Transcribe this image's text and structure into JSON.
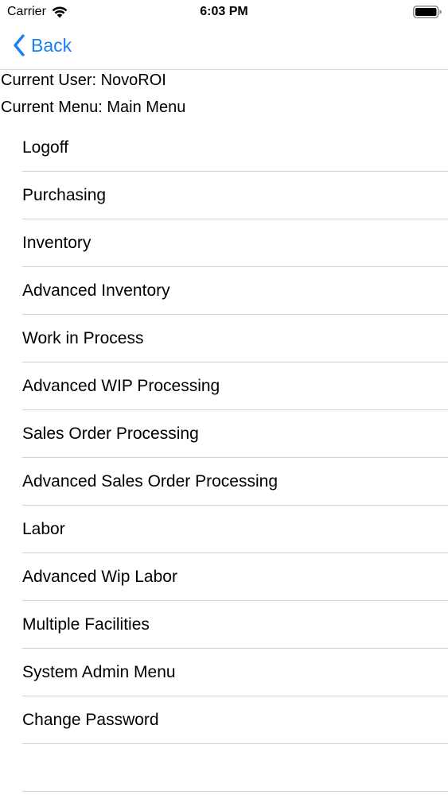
{
  "status_bar": {
    "carrier": "Carrier",
    "time": "6:03 PM",
    "wifi_icon": "wifi-icon",
    "battery_icon": "battery-icon"
  },
  "nav": {
    "back_label": "Back",
    "back_icon": "chevron-left-icon",
    "accent_color": "#1a7ff5"
  },
  "info": {
    "current_user": "Current User: NovoROI",
    "current_menu": "Current Menu: Main Menu"
  },
  "menu": {
    "items": [
      {
        "label": "Logoff"
      },
      {
        "label": "Purchasing"
      },
      {
        "label": "Inventory"
      },
      {
        "label": "Advanced Inventory"
      },
      {
        "label": "Work in Process"
      },
      {
        "label": "Advanced WIP Processing"
      },
      {
        "label": "Sales Order Processing"
      },
      {
        "label": "Advanced Sales Order Processing"
      },
      {
        "label": "Labor"
      },
      {
        "label": "Advanced Wip Labor"
      },
      {
        "label": "Multiple Facilities"
      },
      {
        "label": "System Admin Menu"
      },
      {
        "label": "Change Password"
      },
      {
        "label": ""
      }
    ]
  }
}
